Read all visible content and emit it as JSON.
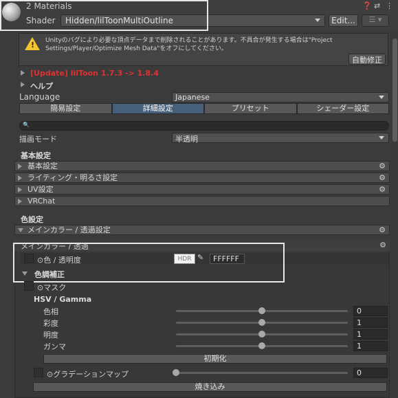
{
  "header": {
    "materials_count": "2 Materials",
    "shader_label": "Shader",
    "shader_value": "Hidden/lilToonMultiOutline",
    "edit_button": "Edit...",
    "icons": [
      "help-icon",
      "settings-sliders-icon",
      "kebab-menu-icon",
      "list-icon"
    ]
  },
  "warning": {
    "text": "Unityのバグにより必要な頂点データまで削除されることがあります。不具合が発生する場合は\"Project Settings/Player/Optimize Mesh Data\"をオフにしてください。",
    "button": "自動修正",
    "icon": "warning-icon"
  },
  "update_notice": "[Update] lilToon 1.7.3 -> 1.8.4",
  "help_label": "ヘルプ",
  "language": {
    "label": "Language",
    "value": "Japanese"
  },
  "tabs": [
    {
      "label": "簡易設定"
    },
    {
      "label": "詳細設定"
    },
    {
      "label": "プリセット"
    },
    {
      "label": "シェーダー設定"
    }
  ],
  "render_mode": {
    "label": "描画モード",
    "value": "半透明"
  },
  "basic_section": {
    "title": "基本設定",
    "items": [
      {
        "label": "基本設定"
      },
      {
        "label": "ライティング・明るさ設定"
      },
      {
        "label": "UV設定"
      },
      {
        "label": "VRChat"
      }
    ]
  },
  "color_section": {
    "title": "色設定",
    "fold_label": "メインカラー / 透過設定",
    "inner_title": "メインカラー / 透過",
    "color_label": "⊙色 / 透明度",
    "hdr_label": "HDR",
    "hex_value": "FFFFFF",
    "correction_label": "色調補正",
    "mask_label": "⊙マスク",
    "hsv_title": "HSV / Gamma",
    "sliders": [
      {
        "label": "色相",
        "value": "0",
        "fraction": 0.5
      },
      {
        "label": "彩度",
        "value": "1",
        "fraction": 0.5
      },
      {
        "label": "明度",
        "value": "1",
        "fraction": 0.5
      },
      {
        "label": "ガンマ",
        "value": "1",
        "fraction": 0.5
      }
    ],
    "reset_button": "初期化",
    "gradient_label": "⊙グラデーションマップ",
    "gradient_value": "0",
    "gradient_fraction": 0.0,
    "bake_button": "焼き込み"
  },
  "colors": {
    "accent_tab": "#46607c",
    "update_red": "#e03030",
    "warning_yellow": "#f2c531"
  }
}
